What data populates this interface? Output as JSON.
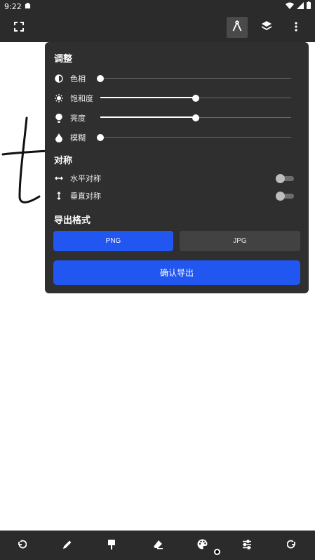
{
  "status": {
    "time": "9:22"
  },
  "panel": {
    "adjust_title": "调整",
    "sliders": [
      {
        "label": "色相",
        "icon": "contrast-icon",
        "value": 0.0
      },
      {
        "label": "饱和度",
        "icon": "saturation-icon",
        "value": 0.5
      },
      {
        "label": "亮度",
        "icon": "brightness-icon",
        "value": 0.5
      },
      {
        "label": "模糊",
        "icon": "blur-icon",
        "value": 0.0
      }
    ],
    "symmetry_title": "对称",
    "symmetry": [
      {
        "label": "水平对称",
        "icon": "horizontal-arrows-icon",
        "enabled": false
      },
      {
        "label": "垂直对称",
        "icon": "vertical-arrows-icon",
        "enabled": false
      }
    ],
    "export_title": "导出格式",
    "format_png": "PNG",
    "format_jpg": "JPG",
    "selected_format": "PNG",
    "confirm_label": "确认导出"
  },
  "colors": {
    "accent": "#2256f0",
    "panel_bg": "#2f2f2f",
    "bar_bg": "#2b2b2b"
  }
}
